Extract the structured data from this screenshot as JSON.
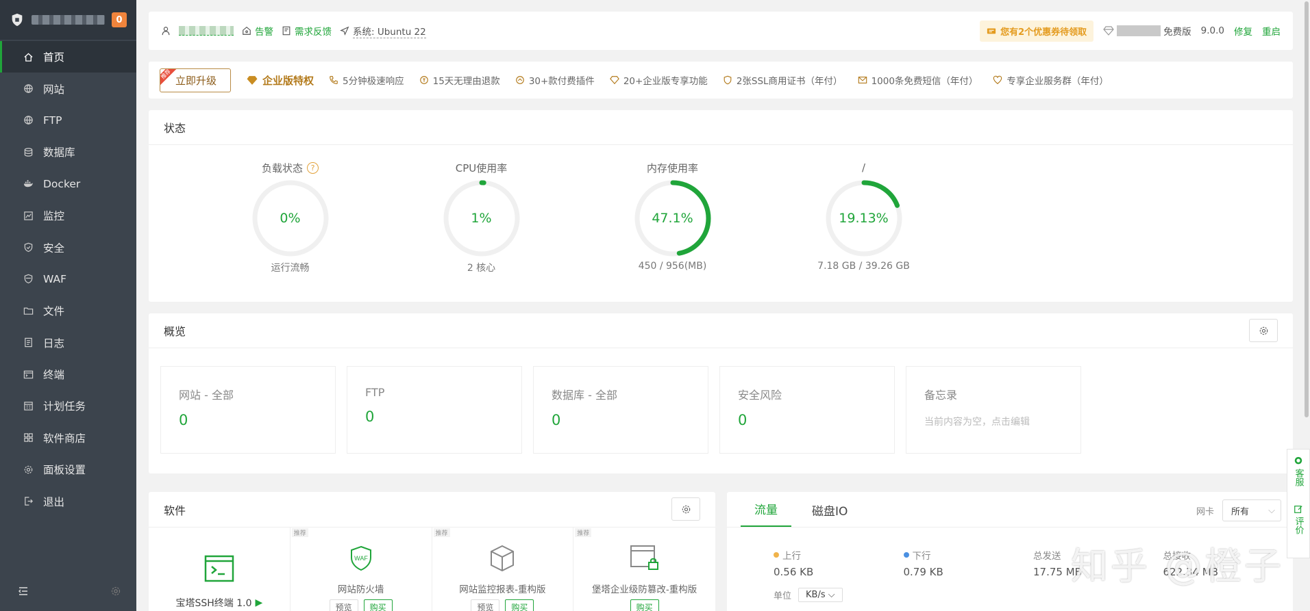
{
  "sidebar": {
    "badge": "0",
    "items": [
      {
        "label": "首页",
        "icon": "home-icon"
      },
      {
        "label": "网站",
        "icon": "globe-icon"
      },
      {
        "label": "FTP",
        "icon": "globe-icon"
      },
      {
        "label": "数据库",
        "icon": "database-icon"
      },
      {
        "label": "Docker",
        "icon": "docker-icon"
      },
      {
        "label": "监控",
        "icon": "monitor-icon"
      },
      {
        "label": "安全",
        "icon": "shield-icon"
      },
      {
        "label": "WAF",
        "icon": "waf-shield-icon"
      },
      {
        "label": "文件",
        "icon": "folder-icon"
      },
      {
        "label": "日志",
        "icon": "log-icon"
      },
      {
        "label": "终端",
        "icon": "terminal-icon"
      },
      {
        "label": "计划任务",
        "icon": "calendar-icon"
      },
      {
        "label": "软件商店",
        "icon": "grid-icon"
      },
      {
        "label": "面板设置",
        "icon": "gear-icon"
      },
      {
        "label": "退出",
        "icon": "logout-icon"
      }
    ]
  },
  "topbar": {
    "alert": "告警",
    "feedback": "需求反馈",
    "system": "系统: Ubuntu 22",
    "promo": "您有2个优惠券待领取",
    "edition": "免费版",
    "version": "9.0.0",
    "repair": "修复",
    "restart": "重启"
  },
  "upgrade": {
    "button": "立即升级",
    "tag": "推荐",
    "title": "企业版特权",
    "features": [
      "5分钟极速响应",
      "15天无理由退款",
      "30+款付费插件",
      "20+企业版专享功能",
      "2张SSL商用证书（年付）",
      "1000条免费短信（年付）",
      "专享企业服务群（年付）"
    ]
  },
  "status": {
    "title": "状态",
    "gauges": [
      {
        "title": "负载状态",
        "value": "0%",
        "sub": "运行流畅",
        "percent": 0
      },
      {
        "title": "CPU使用率",
        "value": "1%",
        "sub": "2 核心",
        "percent": 1
      },
      {
        "title": "内存使用率",
        "value": "47.1%",
        "sub": "450 / 956(MB)",
        "percent": 47.1
      },
      {
        "title": "/",
        "value": "19.13%",
        "sub": "7.18 GB / 39.26 GB",
        "percent": 19.13
      }
    ]
  },
  "overview": {
    "title": "概览",
    "boxes": [
      {
        "label": "网站 - 全部",
        "value": "0"
      },
      {
        "label": "FTP",
        "value": "0"
      },
      {
        "label": "数据库 - 全部",
        "value": "0"
      },
      {
        "label": "安全风险",
        "value": "0"
      }
    ],
    "memo": {
      "label": "备忘录",
      "note": "当前内容为空，点击编辑"
    }
  },
  "software": {
    "title": "软件",
    "items": [
      {
        "name": "宝塔SSH终端 1.0"
      },
      {
        "tag": "推荐",
        "name": "网站防火墙",
        "btn1": "预览",
        "btn2": "购买"
      },
      {
        "tag": "推荐",
        "name": "网站监控报表-重构版",
        "btn1": "预览",
        "btn2": "购买"
      },
      {
        "tag": "推荐",
        "name": "堡塔企业级防篡改-重构版",
        "btn2": "购买"
      }
    ]
  },
  "traffic": {
    "tabs": [
      "流量",
      "磁盘IO"
    ],
    "nic_label": "网卡",
    "nic_value": "所有",
    "stats": [
      {
        "label": "上行",
        "value": "0.56 KB",
        "color": "#f0b34a"
      },
      {
        "label": "下行",
        "value": "0.79 KB",
        "color": "#4a90e2"
      },
      {
        "label": "总发送",
        "value": "17.75 MB"
      },
      {
        "label": "总接收",
        "value": "622.34 MB"
      }
    ],
    "unit_label": "单位",
    "unit_value": "KB/s"
  },
  "float": {
    "service": "客服",
    "review": "评价"
  },
  "watermark": "知乎 @橙子",
  "colors": {
    "accent": "#20a53a",
    "sidebar": "#3c444d",
    "promo": "#e49b1f"
  }
}
